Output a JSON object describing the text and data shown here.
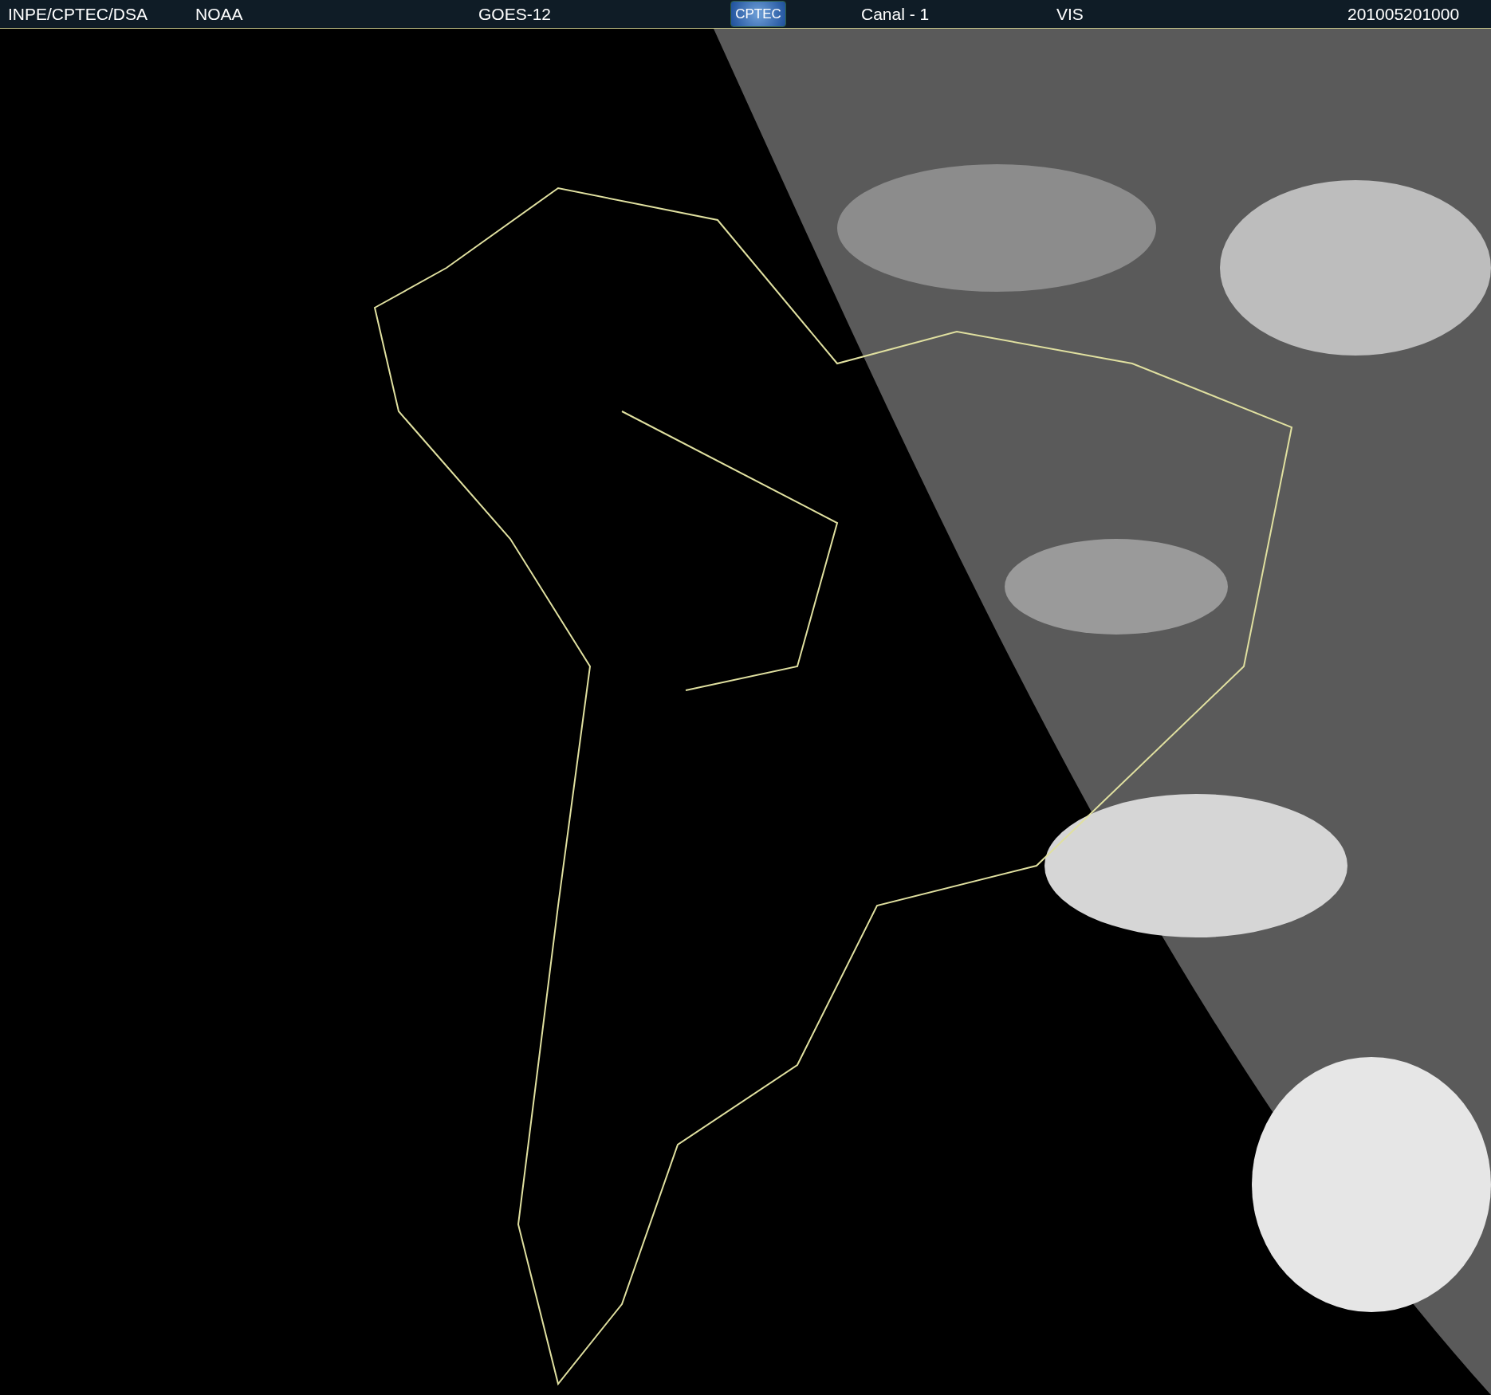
{
  "header": {
    "items": [
      {
        "kind": "text",
        "text": "INPE/CPTEC/DSA"
      },
      {
        "kind": "text",
        "text": "NOAA"
      },
      {
        "kind": "text",
        "text": "GOES-12"
      },
      {
        "kind": "logo",
        "text": "CPTEC"
      },
      {
        "kind": "text",
        "text": "Canal - 1"
      },
      {
        "kind": "text",
        "text": "VIS"
      },
      {
        "kind": "text",
        "text": "201005201000"
      }
    ]
  }
}
